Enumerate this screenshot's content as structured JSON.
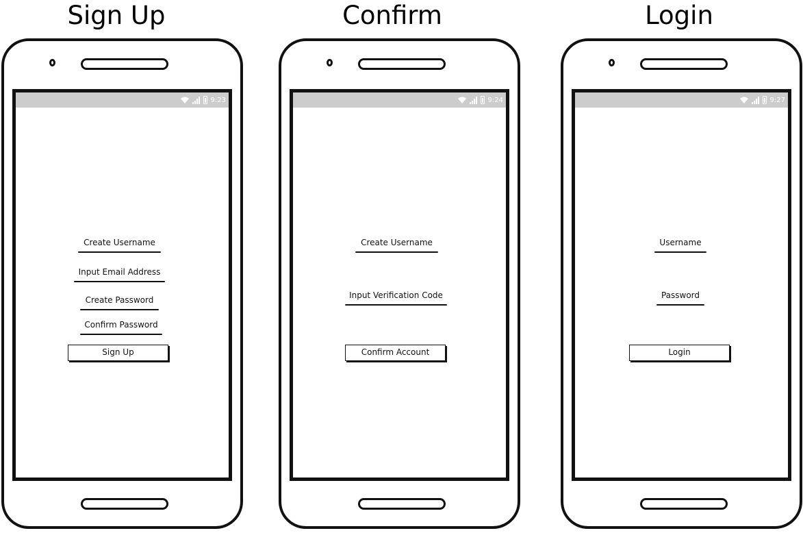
{
  "screens": [
    {
      "title": "Sign Up",
      "time": "9:23",
      "fields": [
        "Create Username",
        "Input Email Address",
        "Create Password",
        "Confirm Password"
      ],
      "button": "Sign Up"
    },
    {
      "title": "Confirm",
      "time": "9:24",
      "fields": [
        "Create Username",
        "Input Verification Code"
      ],
      "button": "Confirm Account"
    },
    {
      "title": "Login",
      "time": "9:27",
      "fields": [
        "Username",
        "Password"
      ],
      "button": "Login"
    }
  ]
}
